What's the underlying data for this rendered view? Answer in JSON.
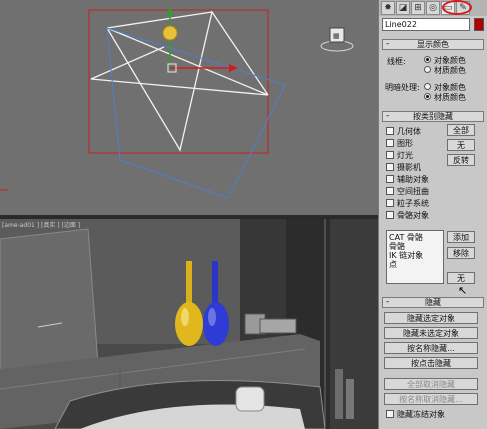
{
  "viewports": {
    "bottom_label": "[ame-ad01 ] [真实 ] [边面 ]",
    "overlay_icon": "cube-icon"
  },
  "panel": {
    "tabs": [
      {
        "name": "create-icon",
        "glyph": "✸"
      },
      {
        "name": "modify-icon",
        "glyph": "◪"
      },
      {
        "name": "hierarchy-icon",
        "glyph": "⊞"
      },
      {
        "name": "motion-icon",
        "glyph": "◎"
      },
      {
        "name": "display-icon",
        "glyph": "▭"
      },
      {
        "name": "utilities-icon",
        "glyph": "✎"
      }
    ],
    "object_name": "Line022",
    "color_swatch": "#b20000",
    "display_color": {
      "title": "显示颜色",
      "wireframe_label": "线框:",
      "shaded_label": "明暗处理:",
      "opt_object_color": "对象颜色",
      "opt_material_color": "材质颜色",
      "wireframe_selected": "对象颜色",
      "shaded_selected": "材质颜色"
    },
    "hide_by_category": {
      "title": "按类别隐藏",
      "categories": [
        "几何体",
        "图形",
        "灯光",
        "摄影机",
        "辅助对象",
        "空间扭曲",
        "粒子系统",
        "骨骼对象"
      ],
      "btn_all": "全部",
      "btn_none": "无",
      "btn_invert": "反转",
      "list_items": [
        "CAT 骨骼",
        "骨骼",
        "IK 链对象",
        "点"
      ],
      "btn_add": "添加",
      "btn_remove": "移除",
      "btn_none2": "无"
    },
    "hide": {
      "title": "隐藏",
      "buttons": [
        "隐藏选定对象",
        "隐藏未选定对象",
        "按名称隐藏...",
        "按点击隐藏"
      ],
      "disabled_buttons": [
        "全部取消隐藏",
        "按名称取消隐藏..."
      ],
      "freeze_label": "隐藏冻结对象"
    }
  }
}
